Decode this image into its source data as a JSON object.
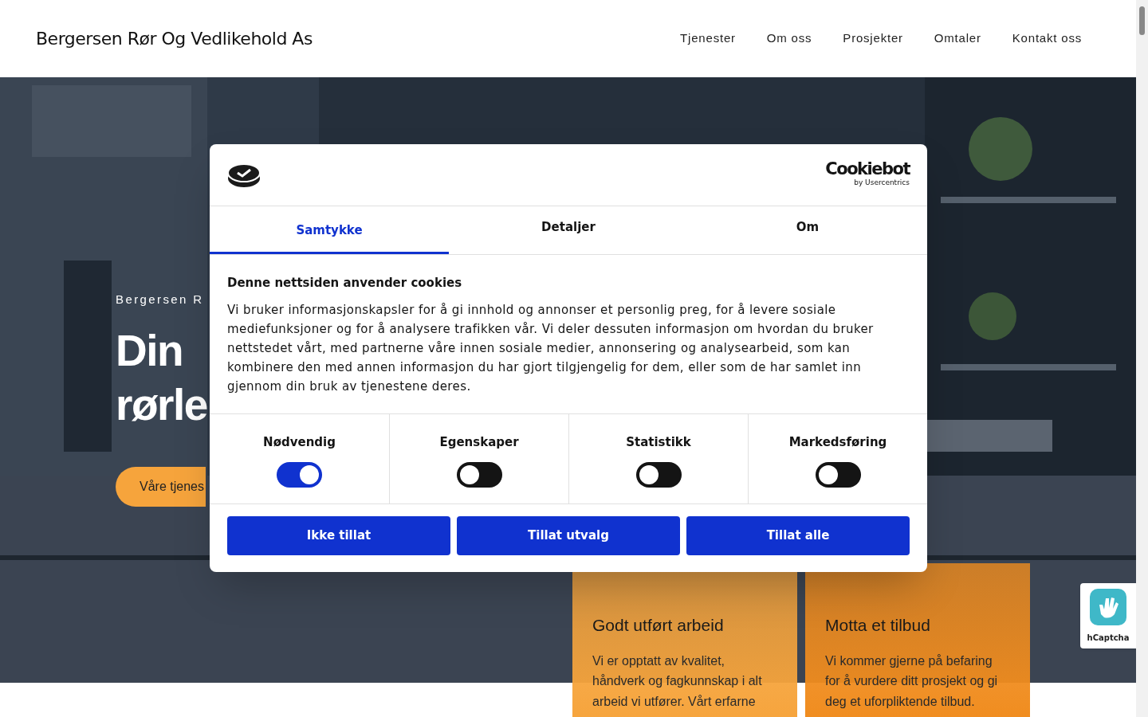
{
  "header": {
    "logo": "Bergersen Rør Og Vedlikehold As",
    "nav": [
      "Tjenester",
      "Om oss",
      "Prosjekter",
      "Omtaler",
      "Kontakt oss"
    ]
  },
  "hero": {
    "kind": "picture",
    "eyebrow": "Bergersen R",
    "title_lines": [
      "Din",
      "rørle"
    ],
    "button": "Våre tjenes"
  },
  "cards": [
    {
      "title": "Godt utført arbeid",
      "lines": [
        "Vi er opptatt av kvalitet,",
        "håndverk og fagkunnskap i alt",
        "arbeid vi utfører. Vårt erfarne"
      ],
      "color": "#f6a43c"
    },
    {
      "title": "Motta et tilbud",
      "lines": [
        "Vi kommer gjerne på befaring",
        "for å vurdere ditt prosjekt og gi",
        "deg et uforpliktende tilbud."
      ],
      "color": "#f08c1e"
    }
  ],
  "captcha": {
    "label": "hCaptcha"
  },
  "cookie_dialog": {
    "brand": "Cookiebot",
    "brand_sub": "by Usercentrics",
    "tabs": [
      {
        "label": "Samtykke",
        "selected": true
      },
      {
        "label": "Detaljer",
        "selected": false
      },
      {
        "label": "Om",
        "selected": false
      }
    ],
    "heading": "Denne nettsiden anvender cookies",
    "body": "Vi bruker informasjonskapsler for å gi innhold og annonser et personlig preg, for å levere sosiale mediefunksjoner og for å analysere trafikken vår. Vi deler dessuten informasjon om hvordan du bruker nettstedet vårt, med partnerne våre innen sosiale medier, annonsering og analysearbeid, som kan kombinere den med annen informasjon du har gjort tilgjengelig for dem, eller som de har samlet inn gjennom din bruk av tjenestene deres.",
    "categories": [
      {
        "label": "Nødvendig",
        "on": true
      },
      {
        "label": "Egenskaper",
        "on": false
      },
      {
        "label": "Statistikk",
        "on": false
      },
      {
        "label": "Markedsføring",
        "on": false
      }
    ],
    "buttons": [
      "Ikke tillat",
      "Tillat utvalg",
      "Tillat alle"
    ]
  }
}
